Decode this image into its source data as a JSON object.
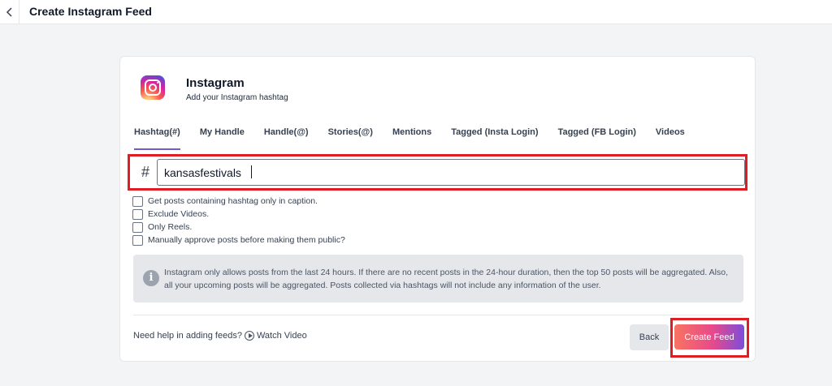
{
  "header": {
    "title": "Create Instagram Feed",
    "back_icon": "chevron-left-icon"
  },
  "platform": {
    "name": "Instagram",
    "subtitle": "Add your Instagram hashtag",
    "icon": "instagram-logo"
  },
  "tabs": [
    {
      "label": "Hashtag(#)",
      "active": true
    },
    {
      "label": "My Handle",
      "active": false
    },
    {
      "label": "Handle(@)",
      "active": false
    },
    {
      "label": "Stories(@)",
      "active": false
    },
    {
      "label": "Mentions",
      "active": false
    },
    {
      "label": "Tagged (Insta Login)",
      "active": false
    },
    {
      "label": "Tagged (FB Login)",
      "active": false
    },
    {
      "label": "Videos",
      "active": false
    }
  ],
  "hashtag": {
    "symbol": "#",
    "value": "kansasfestivals"
  },
  "options": [
    {
      "label": "Get posts containing hashtag only in caption.",
      "checked": false
    },
    {
      "label": "Exclude Videos.",
      "checked": false
    },
    {
      "label": "Only Reels.",
      "checked": false
    },
    {
      "label": "Manually approve posts before making them public?",
      "checked": false
    }
  ],
  "info": {
    "icon": "info-icon",
    "text": "Instagram only allows posts from the last 24 hours. If there are no recent posts in the 24-hour duration, then the top 50 posts will be aggregated. Also, all your upcoming posts will be aggregated. Posts collected via hashtags will not include any information of the user."
  },
  "footer": {
    "help_text": "Need help in adding feeds?",
    "watch_label": "Watch Video",
    "back_label": "Back",
    "create_label": "Create Feed"
  },
  "colors": {
    "accent": "#6d5bd0",
    "highlight": "#e11d24",
    "gradient_start": "#f97362",
    "gradient_end": "#7c4ddc"
  }
}
